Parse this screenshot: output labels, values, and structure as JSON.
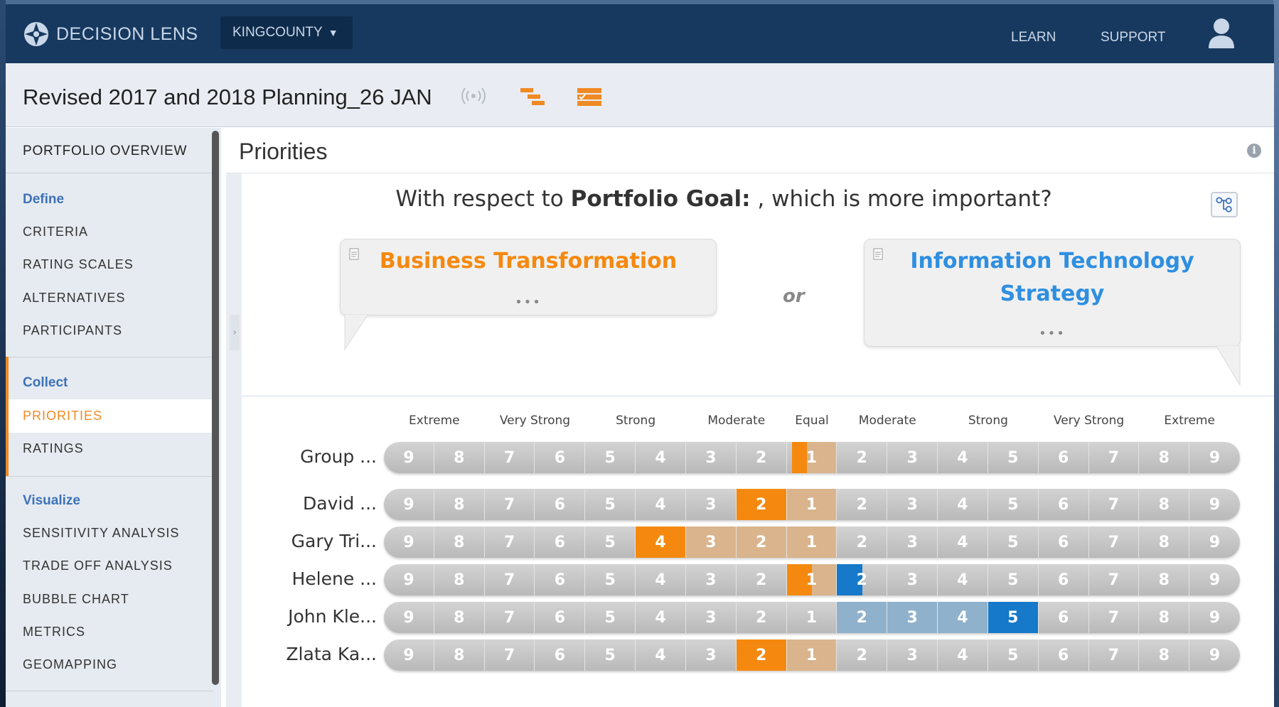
{
  "nav": {
    "brand": "DECISION LENS",
    "org": "KINGCOUNTY",
    "learn": "LEARN",
    "support": "SUPPORT"
  },
  "titlebar": {
    "title": "Revised 2017 and 2018 Planning_26 JAN"
  },
  "sidebar": {
    "overview": "PORTFOLIO OVERVIEW",
    "define": "Define",
    "define_items": [
      "CRITERIA",
      "RATING SCALES",
      "ALTERNATIVES",
      "PARTICIPANTS"
    ],
    "collect": "Collect",
    "collect_items": [
      "PRIORITIES",
      "RATINGS"
    ],
    "active_item": "PRIORITIES",
    "visualize": "Visualize",
    "visualize_items": [
      "SENSITIVITY ANALYSIS",
      "TRADE OFF ANALYSIS",
      "BUBBLE CHART",
      "METRICS",
      "GEOMAPPING"
    ]
  },
  "main": {
    "title": "Priorities",
    "question_prefix": "With respect to ",
    "question_goal": "Portfolio Goal:",
    "question_suffix": " , which is more important?",
    "left_option": "Business Transformation",
    "right_option": "Information Technology Strategy",
    "or": "or",
    "more": "•••"
  },
  "scale": {
    "labels": [
      "Extreme",
      "Very Strong",
      "Strong",
      "Moderate",
      "Equal",
      "Moderate",
      "Strong",
      "Very Strong",
      "Extreme"
    ],
    "cells": [
      "9",
      "8",
      "7",
      "6",
      "5",
      "4",
      "3",
      "2",
      "1",
      "2",
      "3",
      "4",
      "5",
      "6",
      "7",
      "8",
      "9"
    ],
    "colors": {
      "left_selected": "#f5890f",
      "left_range": "#d9b48c",
      "right_selected": "#1679c9",
      "right_range": "#8fb1cc"
    }
  },
  "judgments": [
    {
      "name": "Group ...",
      "side": "left",
      "value": 1.6
    },
    {
      "name": "David ...",
      "side": "left",
      "value": 2
    },
    {
      "name": "Gary Tri...",
      "side": "left",
      "value": 4
    },
    {
      "name": "Helene ...",
      "side": "left",
      "value": 1
    },
    {
      "name": "John Kle...",
      "side": "right",
      "value": 4
    },
    {
      "name": "Zlata Ka...",
      "side": "left",
      "value": 2
    }
  ]
}
